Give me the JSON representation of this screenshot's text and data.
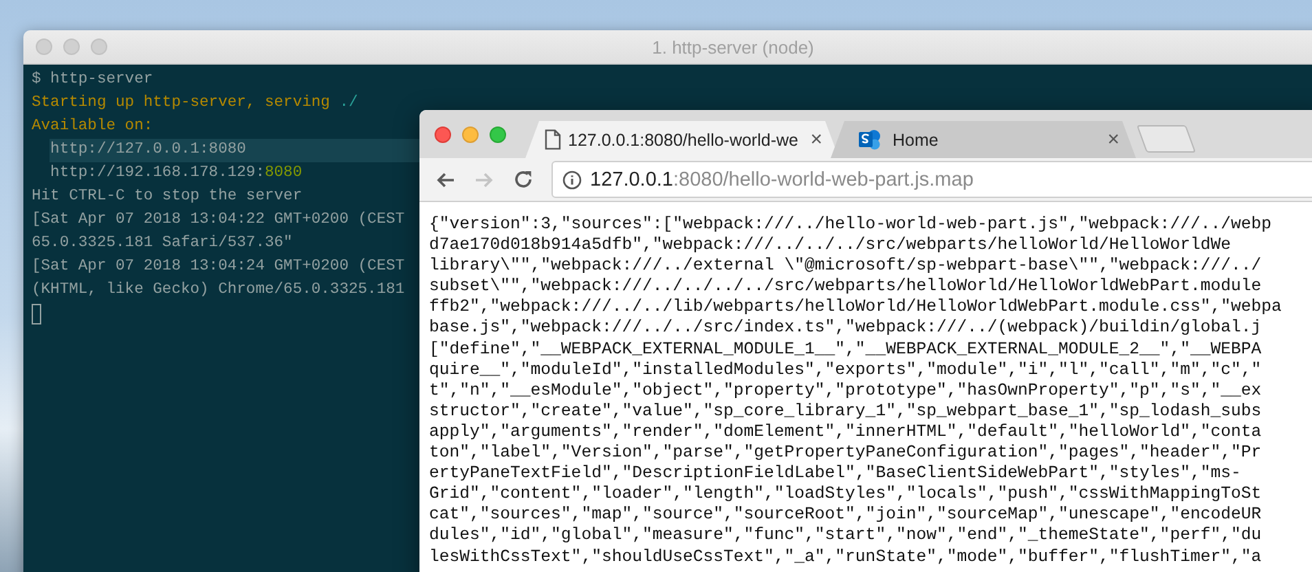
{
  "terminal": {
    "title": "1. http-server (node)",
    "lines": [
      {
        "highlighted": false,
        "segments": [
          {
            "text": "$ http-server",
            "kind": "plain"
          }
        ]
      },
      {
        "highlighted": false,
        "segments": [
          {
            "text": "Starting up http-server, serving ",
            "kind": "warning"
          },
          {
            "text": "./",
            "kind": "path"
          }
        ]
      },
      {
        "highlighted": false,
        "segments": [
          {
            "text": "Available on:",
            "kind": "warning"
          }
        ]
      },
      {
        "highlighted": true,
        "segments": [
          {
            "text": "  http://127.0.0.1:8080",
            "kind": "plain"
          }
        ]
      },
      {
        "highlighted": false,
        "segments": [
          {
            "text": "  http://192.168.178.129:",
            "kind": "plain"
          },
          {
            "text": "8080",
            "kind": "accent"
          }
        ]
      },
      {
        "highlighted": false,
        "segments": [
          {
            "text": "Hit CTRL-C to stop the server",
            "kind": "plain"
          }
        ]
      },
      {
        "highlighted": false,
        "segments": [
          {
            "text": "[Sat Apr 07 2018 13:04:22 GMT+0200 (CEST",
            "kind": "plain"
          }
        ]
      },
      {
        "highlighted": false,
        "segments": [
          {
            "text": "65.0.3325.181 Safari/537.36\"",
            "kind": "plain"
          }
        ]
      },
      {
        "highlighted": false,
        "segments": [
          {
            "text": "[Sat Apr 07 2018 13:04:24 GMT+0200 (CEST",
            "kind": "plain"
          }
        ]
      },
      {
        "highlighted": false,
        "segments": [
          {
            "text": "(KHTML, like Gecko) Chrome/65.0.3325.181",
            "kind": "plain"
          }
        ]
      }
    ]
  },
  "browser": {
    "tabs": [
      {
        "title": "127.0.0.1:8080/hello-world-we",
        "close": "×",
        "kind": "page",
        "selected": true
      },
      {
        "title": "Home",
        "close": "×",
        "kind": "site",
        "selected": false
      }
    ],
    "nav_buttons": [
      {
        "kind": "back",
        "disabled": false
      },
      {
        "kind": "forward",
        "disabled": true
      },
      {
        "kind": "reload",
        "disabled": false
      }
    ],
    "address": {
      "host": "127.0.0.1",
      "rest": ":8080/hello-world-web-part.js.map"
    },
    "content_lines": [
      "{\"version\":3,\"sources\":[\"webpack:///../hello-world-web-part.js\",\"webpack:///../webp",
      "d7ae170d018b914a5dfb\",\"webpack:///../../../src/webparts/helloWorld/HelloWorldWe",
      "library\\\"\",\"webpack:///../external \\\"@microsoft/sp-webpart-base\\\"\",\"webpack:///../",
      "subset\\\"\",\"webpack:///../../../../src/webparts/helloWorld/HelloWorldWebPart.module",
      "ffb2\",\"webpack:///../../lib/webparts/helloWorld/HelloWorldWebPart.module.css\",\"webpa",
      "base.js\",\"webpack:///../../src/index.ts\",\"webpack:///../(webpack)/buildin/global.j",
      "[\"define\",\"__WEBPACK_EXTERNAL_MODULE_1__\",\"__WEBPACK_EXTERNAL_MODULE_2__\",\"__WEBPA",
      "quire__\",\"moduleId\",\"installedModules\",\"exports\",\"module\",\"i\",\"l\",\"call\",\"m\",\"c\",\"",
      "t\",\"n\",\"__esModule\",\"object\",\"property\",\"prototype\",\"hasOwnProperty\",\"p\",\"s\",\"__ex",
      "structor\",\"create\",\"value\",\"sp_core_library_1\",\"sp_webpart_base_1\",\"sp_lodash_subs",
      "apply\",\"arguments\",\"render\",\"domElement\",\"innerHTML\",\"default\",\"helloWorld\",\"conta",
      "ton\",\"label\",\"Version\",\"parse\",\"getPropertyPaneConfiguration\",\"pages\",\"header\",\"Pr",
      "ertyPaneTextField\",\"DescriptionFieldLabel\",\"BaseClientSideWebPart\",\"styles\",\"ms-",
      "Grid\",\"content\",\"loader\",\"length\",\"loadStyles\",\"locals\",\"push\",\"cssWithMappingToSt",
      "cat\",\"sources\",\"map\",\"source\",\"sourceRoot\",\"join\",\"sourceMap\",\"unescape\",\"encodeUR",
      "dules\",\"id\",\"global\",\"measure\",\"func\",\"start\",\"now\",\"end\",\"_themeState\",\"perf\",\"du",
      "lesWithCssText\",\"shouldUseCssText\",\"_a\",\"runState\",\"mode\",\"buffer\",\"flushTimer\",\"a"
    ]
  }
}
